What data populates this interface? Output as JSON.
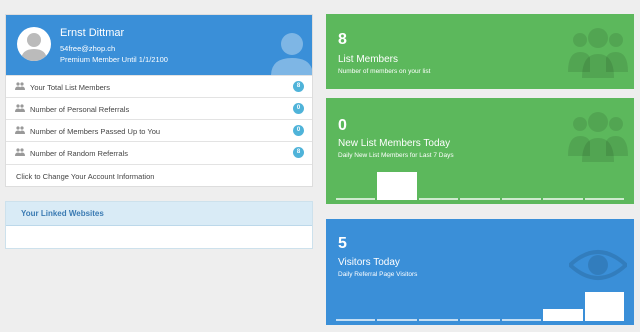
{
  "profile": {
    "name": "Ernst Dittmar",
    "email": "54free@zhop.ch",
    "status": "Premium Member Until 1/1/2100"
  },
  "stats": [
    {
      "label": "Your Total List Members",
      "value": "8"
    },
    {
      "label": "Number of Personal Referrals",
      "value": "0"
    },
    {
      "label": "Number of Members Passed Up to You",
      "value": "0"
    },
    {
      "label": "Number of Random Referrals",
      "value": "8"
    }
  ],
  "change_account_link": "Click to Change Your Account Information",
  "linked_websites": {
    "title": "Your Linked Websites"
  },
  "tiles": [
    {
      "value": "8",
      "title": "List Members",
      "subtitle": "Number of members on your list",
      "icon": "users-icon",
      "color": "#5cb85c"
    },
    {
      "value": "0",
      "title": "New List Members Today",
      "subtitle": "Daily New List Members for Last 7 Days",
      "icon": "users-icon",
      "color": "#5cb85c",
      "bars": [
        0,
        1,
        0,
        0,
        0,
        0,
        0
      ]
    },
    {
      "value": "5",
      "title": "Visitors Today",
      "subtitle": "Daily Referral Page Visitors",
      "icon": "eye-icon",
      "color": "#3a8fd8",
      "bars": [
        0,
        0,
        0,
        0,
        0,
        0.4,
        1
      ]
    }
  ]
}
